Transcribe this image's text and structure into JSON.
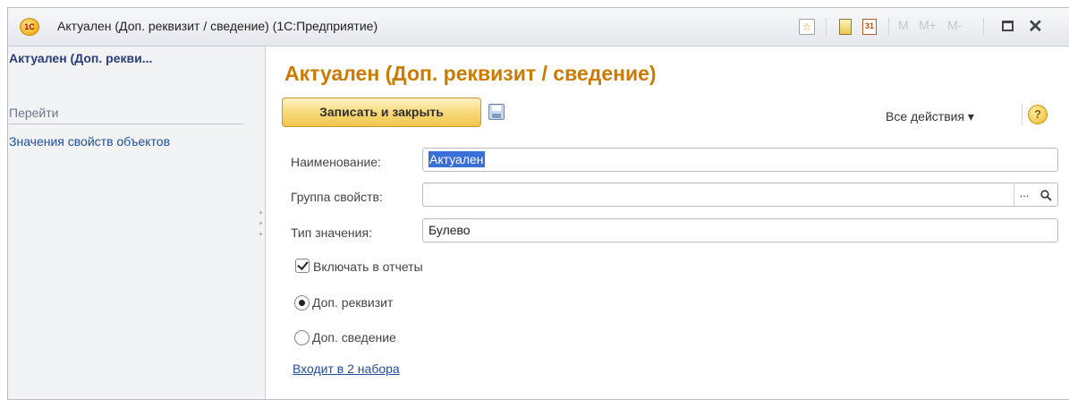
{
  "window": {
    "title": "Актуален (Доп. реквизит / сведение) (1С:Предприятие)",
    "logo_text": "1С",
    "toolbar": {
      "calendar_label": "31",
      "memory": [
        "M",
        "M+",
        "M-"
      ]
    }
  },
  "sidebar": {
    "title": "Актуален (Доп. рекви...",
    "section": "Перейти",
    "items": [
      {
        "label": "Значения свойств объектов"
      }
    ]
  },
  "main": {
    "title": "Актуален (Доп. реквизит / сведение)",
    "toolbar": {
      "save_close_label": "Записать и закрыть",
      "all_actions_label": "Все действия ▾",
      "help_label": "?"
    },
    "fields": {
      "name": {
        "label": "Наименование:",
        "value": "Актуален"
      },
      "group": {
        "label": "Группа свойств:",
        "value": "",
        "choice_label": "..."
      },
      "type": {
        "label": "Тип значения:",
        "value": "Булево"
      }
    },
    "include_in_reports": {
      "label": "Включать в отчеты",
      "checked": true
    },
    "kind_options": [
      {
        "label": "Доп. реквизит",
        "selected": true
      },
      {
        "label": "Доп. сведение",
        "selected": false
      }
    ],
    "sets_link": "Входит в 2 набора"
  }
}
